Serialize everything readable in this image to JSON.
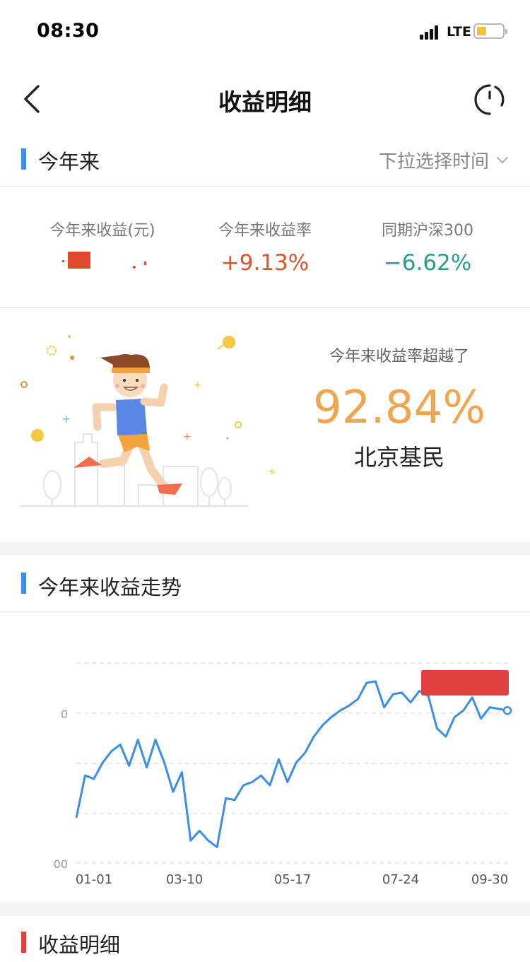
{
  "status_bar": {
    "time": "08:30",
    "network": "LTE",
    "battery_level": 0.35
  },
  "nav": {
    "title": "收益明细",
    "back_icon": "chevron-left-icon",
    "refresh_icon": "refresh-icon"
  },
  "year_section": {
    "title": "今年来",
    "accent": "#3a8ee6",
    "picker_label": "下拉选择时间",
    "picker_icon": "chevron-down-icon"
  },
  "stats": [
    {
      "label": "今年来收益(元)",
      "value": "",
      "color": "#e04a2c"
    },
    {
      "label": "今年来收益率",
      "value": "+9.13%",
      "color": "#e0522c"
    },
    {
      "label": "同期沪深300",
      "value": "−6.62%",
      "color": "#2a9d8f"
    }
  ],
  "ranking": {
    "label": "今年来收益率超越了",
    "value": "92.84%",
    "group": "北京基民",
    "value_color": "#f0a650"
  },
  "trend_section": {
    "title": "今年来收益走势",
    "accent": "#3a8ee6"
  },
  "chart_data": {
    "type": "line",
    "x_tick_labels": [
      "01-01",
      "03-10",
      "05-17",
      "07-24",
      "09-30"
    ],
    "y_tick_labels": [
      "",
      "0",
      "",
      "",
      "00"
    ],
    "series": [
      {
        "color": "#3a8ee6",
        "values": [
          2.0,
          4.6,
          4.4,
          5.4,
          6.1,
          6.5,
          5.2,
          6.8,
          5.1,
          6.8,
          5.4,
          3.6,
          4.8,
          0.6,
          1.2,
          0.6,
          0.2,
          3.2,
          3.1,
          4.0,
          4.2,
          4.6,
          4.0,
          5.6,
          4.2,
          5.4,
          6.0,
          7.0,
          7.7,
          8.2,
          8.6,
          8.9,
          9.3,
          10.3,
          10.4,
          8.8,
          9.6,
          9.7,
          9.1,
          9.8,
          9.5,
          7.5,
          7.0,
          8.2,
          8.6,
          9.4,
          8.1,
          8.8,
          8.7,
          8.6
        ]
      }
    ],
    "tooltip_color": "#e04040",
    "grid": true
  },
  "detail_section": {
    "title": "收益明细",
    "accent": "#e04040"
  }
}
